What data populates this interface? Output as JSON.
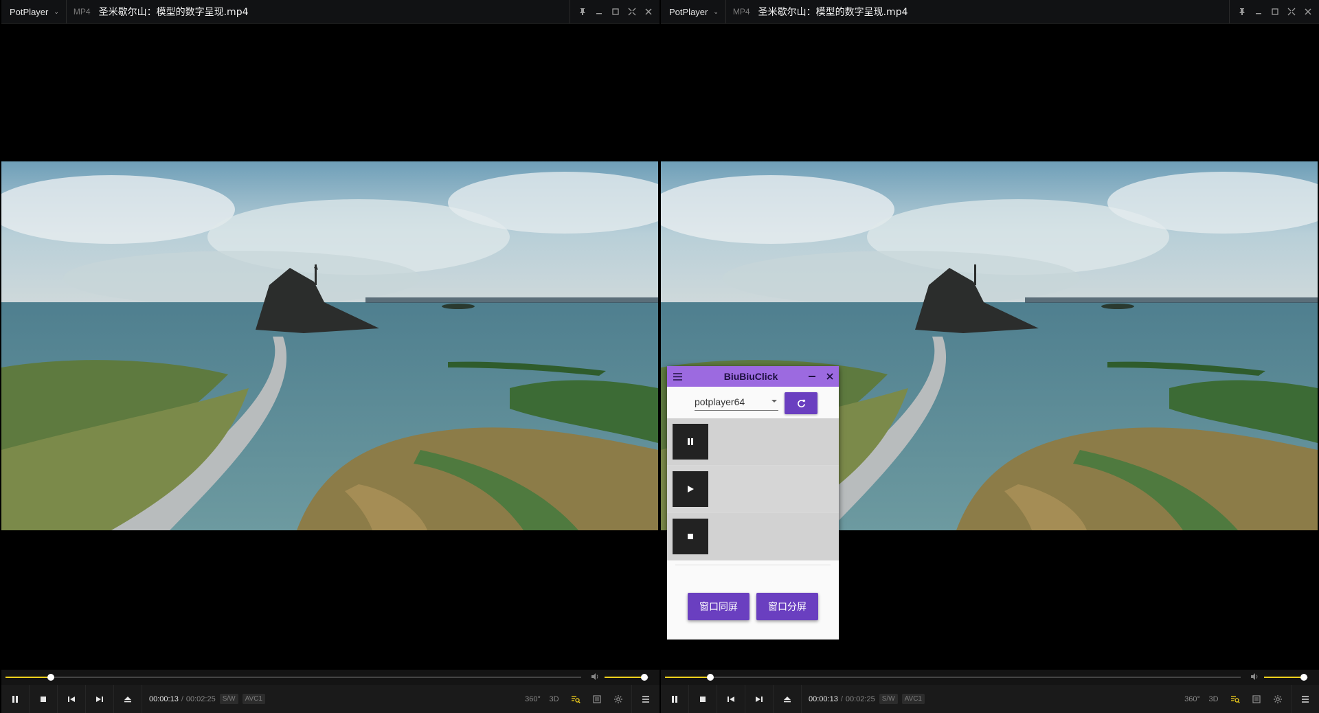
{
  "players": {
    "left": {
      "brand": "PotPlayer",
      "format": "MP4",
      "file_title": "圣米歇尔山：模型的数字呈现.mp4",
      "current_time": "00:00:13",
      "separator": "/",
      "total_time": "00:02:25",
      "tag_sw": "S/W",
      "tag_codec": "AVC1",
      "tool_360": "360°",
      "tool_3d": "3D",
      "seek_progress": 0.079,
      "volume_level": 0.9
    },
    "right": {
      "brand": "PotPlayer",
      "format": "MP4",
      "file_title": "圣米歇尔山：模型的数字呈现.mp4",
      "current_time": "00:00:13",
      "separator": "/",
      "total_time": "00:02:25",
      "tag_sw": "S/W",
      "tag_codec": "AVC1",
      "tool_360": "360°",
      "tool_3d": "3D",
      "seek_progress": 0.079,
      "volume_level": 0.9
    }
  },
  "widget": {
    "title": "BiuBiuClick",
    "target_select": "potplayer64",
    "buttons": {
      "sync": "窗口同屏",
      "split": "窗口分屏"
    },
    "list_items": [
      "pause-icon",
      "play-icon",
      "stop-icon"
    ]
  },
  "colors": {
    "accent_yellow": "#f5d21c",
    "widget_header": "#9c6ae0",
    "widget_button": "#6a3fc0"
  }
}
